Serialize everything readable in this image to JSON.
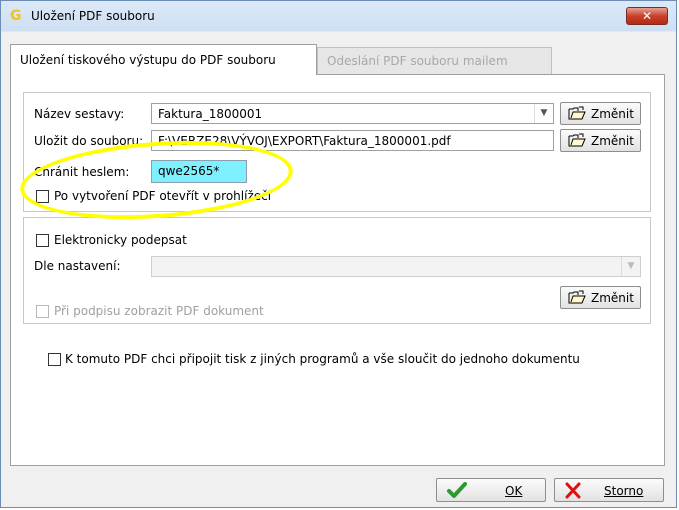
{
  "window": {
    "title": "Uložení PDF souboru",
    "close_label": "✕"
  },
  "tabs": [
    {
      "label": "Uložení tiskového výstupu do PDF souboru"
    },
    {
      "label": "Odeslání PDF souboru mailem"
    }
  ],
  "form": {
    "report_name_label": "Název sestavy:",
    "report_name_value": "Faktura_1800001",
    "save_to_label": "Uložit do souboru:",
    "save_to_value": "F:\\VERZE28\\VÝVOJ\\EXPORT\\Faktura_1800001.pdf",
    "password_label": "Chránit heslem:",
    "password_value": "qwe2565*",
    "open_after_label": "Po vytvoření PDF otevřít v prohlížeči",
    "change_label": "Změnit"
  },
  "signature": {
    "sign_label": "Elektronicky podepsat",
    "settings_label": "Dle nastavení:",
    "settings_value": "",
    "show_pdf_label": "Při podpisu zobrazit PDF dokument",
    "change_label": "Změnit"
  },
  "merge": {
    "label": "K tomuto PDF chci připojit tisk z jiných programů a vše sloučit do jednoho dokumentu"
  },
  "footer": {
    "ok_label": "OK",
    "cancel_label": "Storno"
  },
  "colors": {
    "password_bg": "#7ff0ff",
    "highlight": "#ffff00",
    "ok_check": "#2e9a2e",
    "cancel_x": "#e01010"
  }
}
